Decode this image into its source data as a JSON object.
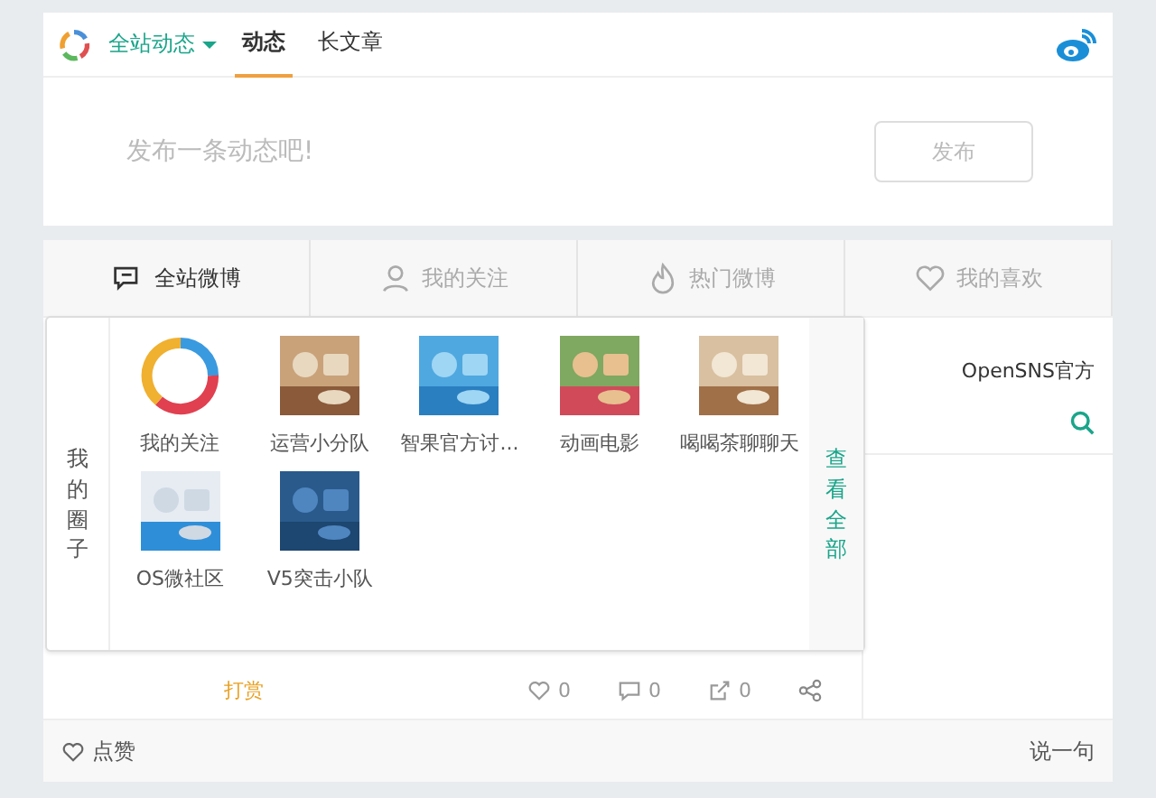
{
  "header": {
    "scope": "全站动态",
    "tabs": [
      {
        "label": "动态",
        "selected": true
      },
      {
        "label": "长文章",
        "selected": false
      }
    ]
  },
  "composer": {
    "placeholder": "发布一条动态吧!",
    "button": "发布"
  },
  "feed_tabs": [
    {
      "label": "全站微博",
      "kind": "chat",
      "selected": true
    },
    {
      "label": "我的关注",
      "kind": "user",
      "selected": false
    },
    {
      "label": "热门微博",
      "kind": "fire",
      "selected": false
    },
    {
      "label": "我的喜欢",
      "kind": "heart",
      "selected": false
    }
  ],
  "side": {
    "title": "OpenSNS官方"
  },
  "post_actions": {
    "reward": "打赏",
    "likes": "0",
    "comments": "0",
    "reposts": "0"
  },
  "comment_bar": {
    "like": "点赞",
    "reply": "说一句"
  },
  "popup": {
    "title": "我的圈子",
    "more": "查看全部",
    "items": [
      {
        "name": "我的关注",
        "kind": "logo"
      },
      {
        "name": "运营小分队",
        "kind": "picture"
      },
      {
        "name": "智果官方讨...",
        "kind": "picture"
      },
      {
        "name": "动画电影",
        "kind": "picture"
      },
      {
        "name": "喝喝茶聊聊天",
        "kind": "picture"
      },
      {
        "name": "OS微社区",
        "kind": "picture"
      },
      {
        "name": "V5突击小队",
        "kind": "picture"
      }
    ]
  }
}
